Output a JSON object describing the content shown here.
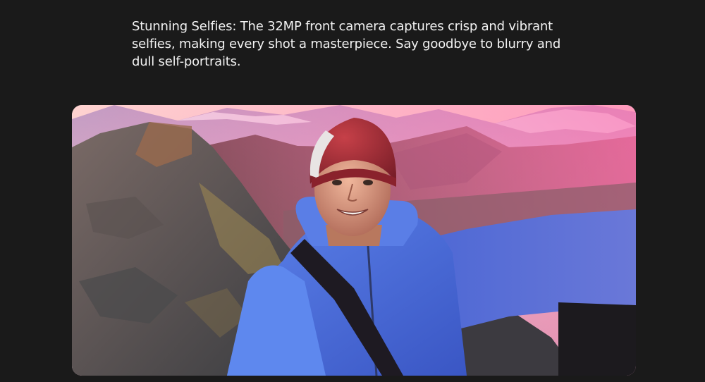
{
  "feature": {
    "description": "Stunning Selfies: The 32MP front camera captures crisp and vibrant selfies, making every shot a masterpiece. Say goodbye to blurry and dull self-portraits."
  },
  "photo": {
    "subject": "selfie of a smiling man in a red beanie and blue jacket on a mountain ridge at sunset"
  },
  "colors": {
    "background": "#1a1a1a",
    "text": "#f2f2f2",
    "jacket": "#4a6fd8",
    "beanie": "#b8323a",
    "sky_glow": "#ffd9c8"
  }
}
